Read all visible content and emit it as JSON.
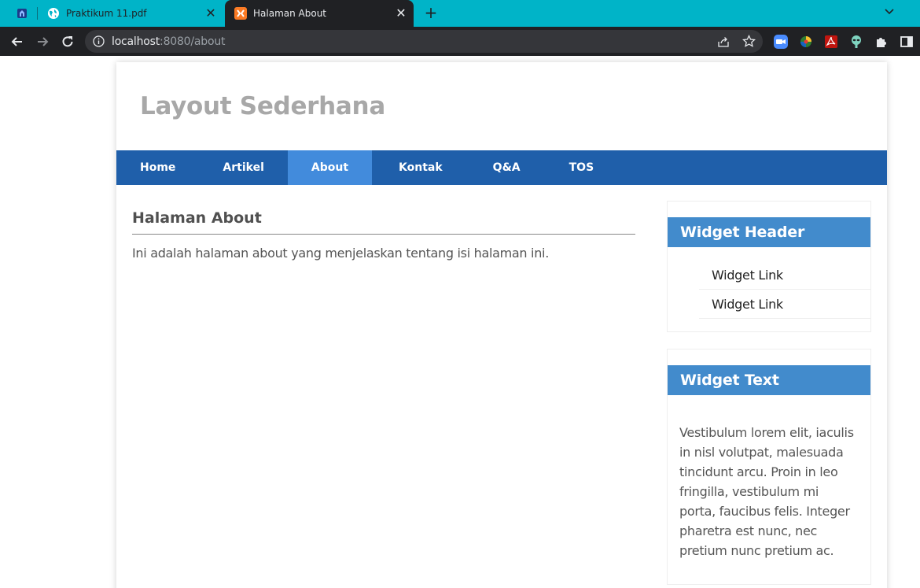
{
  "browser": {
    "tabs": [
      {
        "title": "Praktikum 11.pdf",
        "active": false
      },
      {
        "title": "Halaman About",
        "active": true
      }
    ],
    "url_host": "localhost",
    "url_rest": ":8080/about",
    "icons": [
      "pinned-site-icon",
      "globe-icon",
      "xampp-icon",
      "close-icon",
      "new-tab-icon",
      "tab-search-icon",
      "back-icon",
      "forward-icon",
      "reload-icon",
      "info-icon",
      "share-icon",
      "star-icon",
      "zoom-extension-icon",
      "colorful-extension-icon",
      "pdf-extension-icon",
      "alien-extension-icon",
      "puzzle-icon",
      "side-panel-icon"
    ]
  },
  "site": {
    "title": "Layout Sederhana",
    "nav": [
      "Home",
      "Artikel",
      "About",
      "Kontak",
      "Q&A",
      "TOS"
    ],
    "active_nav": "About"
  },
  "content": {
    "heading": "Halaman About",
    "body": "Ini adalah halaman about yang menjelaskan tentang isi halaman ini."
  },
  "sidebar": {
    "widget1": {
      "header": "Widget Header",
      "links": [
        "Widget Link",
        "Widget Link"
      ]
    },
    "widget2": {
      "header": "Widget Text",
      "text": "Vestibulum lorem elit, iaculis in nisl volutpat, malesuada tincidunt arcu. Proin in leo fringilla, vestibulum mi porta, faucibus felis. Integer pharetra est nunc, nec pretium nunc pretium ac."
    }
  },
  "colors": {
    "tabbar": "#00b4c8",
    "toolbar": "#202124",
    "nav": "#1f5faa",
    "nav_active": "#428bdc",
    "widget_header": "#428bcc"
  }
}
